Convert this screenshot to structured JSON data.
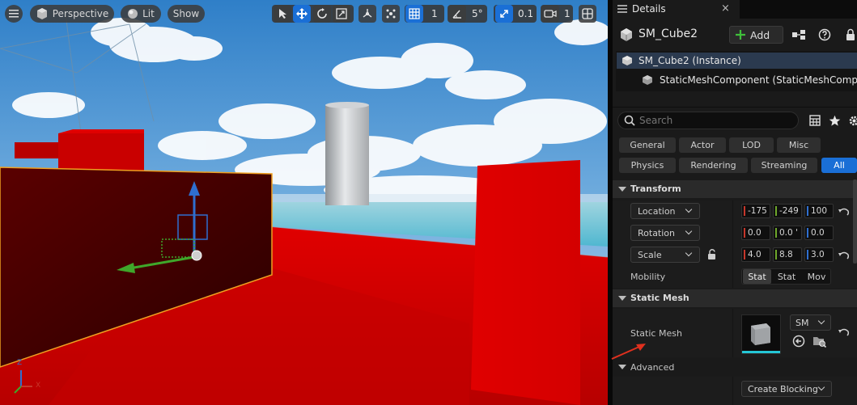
{
  "viewport": {
    "toolbar": {
      "menu_icon": "hamburger-icon",
      "perspective_label": "Perspective",
      "lit_label": "Lit",
      "show_label": "Show",
      "grid_snap_value": "1",
      "rotation_snap_value": "5°",
      "scale_snap_value": "0.1",
      "camera_speed_value": "1",
      "active_color": "#1a6fd6"
    },
    "axis_labels": {
      "z": "Z",
      "x": "X"
    },
    "annotation_color": "#e0301e"
  },
  "details": {
    "tab_title": "Details",
    "tab_close": "×",
    "actor_name": "SM_Cube2",
    "add_label": "Add",
    "components": [
      {
        "label": "SM_Cube2 (Instance)",
        "selected": true
      },
      {
        "label": "StaticMeshComponent (StaticMeshComponent)",
        "selected": false
      }
    ],
    "search_placeholder": "Search",
    "filters_row1": [
      "General",
      "Actor",
      "LOD",
      "Misc"
    ],
    "filters_row2": [
      "Physics",
      "Rendering",
      "Streaming",
      "All"
    ],
    "active_filter": "All",
    "transform": {
      "header": "Transform",
      "location": {
        "label": "Location",
        "x": "-175",
        "y": "-249",
        "z": "100"
      },
      "rotation": {
        "label": "Rotation",
        "x": "0.0",
        "y": "0.0 '",
        "z": "0.0"
      },
      "scale": {
        "label": "Scale",
        "x": "4.0",
        "y": "8.8",
        "z": "3.0"
      },
      "mobility": {
        "label": "Mobility",
        "options": [
          "Stat",
          "Stat",
          "Mov"
        ],
        "selected": 0
      }
    },
    "static_mesh": {
      "header": "Static Mesh",
      "property_label": "Static Mesh",
      "asset_value": "SM"
    },
    "advanced": {
      "header": "Advanced",
      "create_blocking_label": "Create Blocking"
    },
    "axis_colors": {
      "x": "#c7372b",
      "y": "#6ea72a",
      "z": "#2f6fd0"
    }
  }
}
